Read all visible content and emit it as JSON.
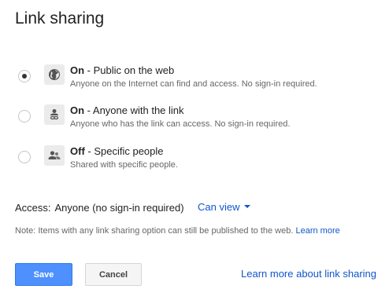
{
  "dialog": {
    "title": "Link sharing"
  },
  "options": [
    {
      "state": "On",
      "separator": " - ",
      "title": "Public on the web",
      "description": "Anyone on the Internet can find and access. No sign-in required.",
      "icon": "globe-icon",
      "selected": true
    },
    {
      "state": "On",
      "separator": " - ",
      "title": "Anyone with the link",
      "description": "Anyone who has the link can access. No sign-in required.",
      "icon": "person-link-icon",
      "selected": false
    },
    {
      "state": "Off",
      "separator": " - ",
      "title": "Specific people",
      "description": "Shared with specific people.",
      "icon": "people-icon",
      "selected": false
    }
  ],
  "access": {
    "label": "Access:",
    "value": "Anyone (no sign-in required)",
    "permission": "Can view"
  },
  "note": {
    "text": "Note: Items with any link sharing option can still be published to the web. ",
    "link": "Learn more"
  },
  "buttons": {
    "save": "Save",
    "cancel": "Cancel"
  },
  "footer": {
    "learn_link": "Learn more about link sharing"
  },
  "colors": {
    "accent": "#1155cc",
    "primary_button": "#4d90fe",
    "muted_text": "#666666"
  }
}
